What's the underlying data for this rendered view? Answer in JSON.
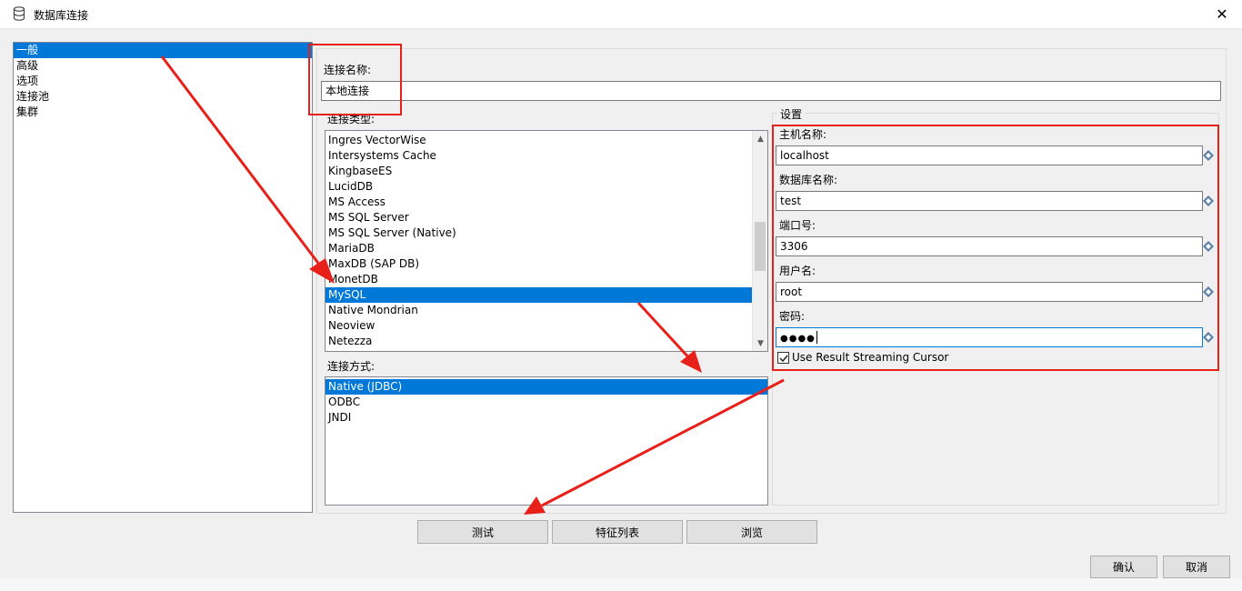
{
  "window": {
    "title": "数据库连接",
    "close_glyph": "✕"
  },
  "nav": {
    "items": [
      {
        "label": "一般",
        "selected": true
      },
      {
        "label": "高级",
        "selected": false
      },
      {
        "label": "选项",
        "selected": false
      },
      {
        "label": "连接池",
        "selected": false
      },
      {
        "label": "集群",
        "selected": false
      }
    ]
  },
  "connection_name": {
    "label": "连接名称:",
    "value": "本地连接"
  },
  "connection_type": {
    "label": "连接类型:",
    "items": [
      {
        "label": "Ingres VectorWise",
        "selected": false
      },
      {
        "label": "Intersystems Cache",
        "selected": false
      },
      {
        "label": "KingbaseES",
        "selected": false
      },
      {
        "label": "LucidDB",
        "selected": false
      },
      {
        "label": "MS Access",
        "selected": false
      },
      {
        "label": "MS SQL Server",
        "selected": false
      },
      {
        "label": "MS SQL Server (Native)",
        "selected": false
      },
      {
        "label": "MariaDB",
        "selected": false
      },
      {
        "label": "MaxDB (SAP DB)",
        "selected": false
      },
      {
        "label": "MonetDB",
        "selected": false
      },
      {
        "label": "MySQL",
        "selected": true
      },
      {
        "label": "Native Mondrian",
        "selected": false
      },
      {
        "label": "Neoview",
        "selected": false
      },
      {
        "label": "Netezza",
        "selected": false
      }
    ]
  },
  "access_method": {
    "label": "连接方式:",
    "items": [
      {
        "label": "Native (JDBC)",
        "selected": true
      },
      {
        "label": "ODBC",
        "selected": false
      },
      {
        "label": "JNDI",
        "selected": false
      }
    ]
  },
  "settings": {
    "title": "设置",
    "fields": [
      {
        "label": "主机名称:",
        "value": "localhost"
      },
      {
        "label": "数据库名称:",
        "value": "test"
      },
      {
        "label": "端口号:",
        "value": "3306"
      },
      {
        "label": "用户名:",
        "value": "root"
      },
      {
        "label": "密码:",
        "value": "●●●●"
      }
    ],
    "streaming_cursor": {
      "label": "Use Result Streaming Cursor",
      "checked": true
    }
  },
  "buttons": {
    "test": "测试",
    "features": "特征列表",
    "browse": "浏览",
    "ok": "确认",
    "cancel": "取消"
  },
  "colors": {
    "selection": "#0078d7",
    "annotation": "#e8201a"
  }
}
